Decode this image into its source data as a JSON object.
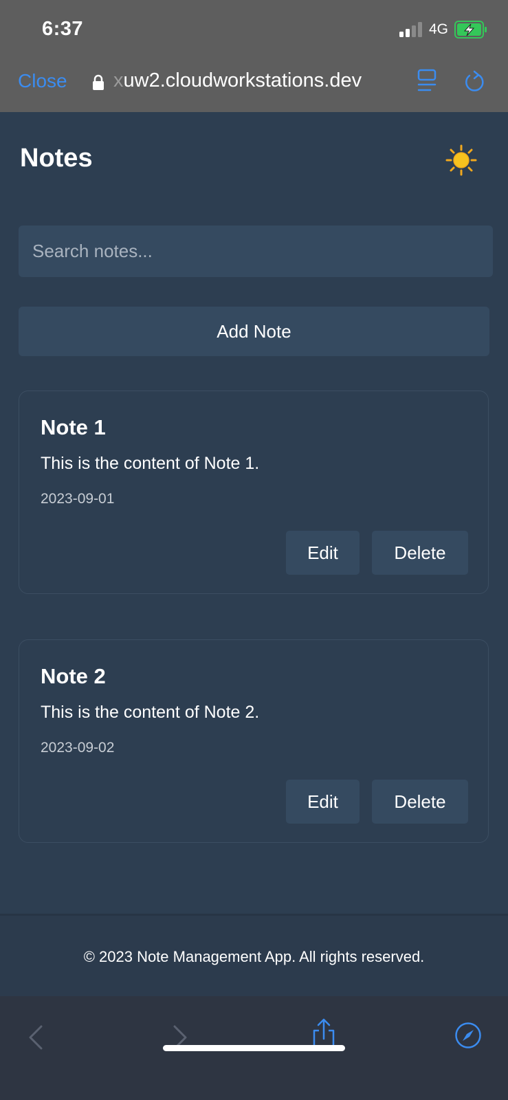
{
  "status_bar": {
    "time": "6:37",
    "network": "4G"
  },
  "browser": {
    "close_label": "Close",
    "url_faded": "x",
    "url": "uw2.cloudworkstations.dev"
  },
  "app": {
    "title": "Notes",
    "search_placeholder": "Search notes...",
    "add_note_label": "Add Note",
    "notes": [
      {
        "title": "Note 1",
        "content": "This is the content of Note 1.",
        "date": "2023-09-01",
        "edit_label": "Edit",
        "delete_label": "Delete"
      },
      {
        "title": "Note 2",
        "content": "This is the content of Note 2.",
        "date": "2023-09-02",
        "edit_label": "Edit",
        "delete_label": "Delete"
      }
    ],
    "footer_text": "© 2023 Note Management App. All rights reserved."
  },
  "colors": {
    "background": "#2d3e51",
    "surface": "#354a60",
    "link_blue": "#3b8cf0",
    "battery_green": "#34c759"
  },
  "icons": [
    "signal-icon",
    "battery-icon",
    "lock-icon",
    "reader-icon",
    "reload-icon",
    "sun-icon",
    "back-icon",
    "forward-icon",
    "share-icon",
    "compass-icon"
  ]
}
